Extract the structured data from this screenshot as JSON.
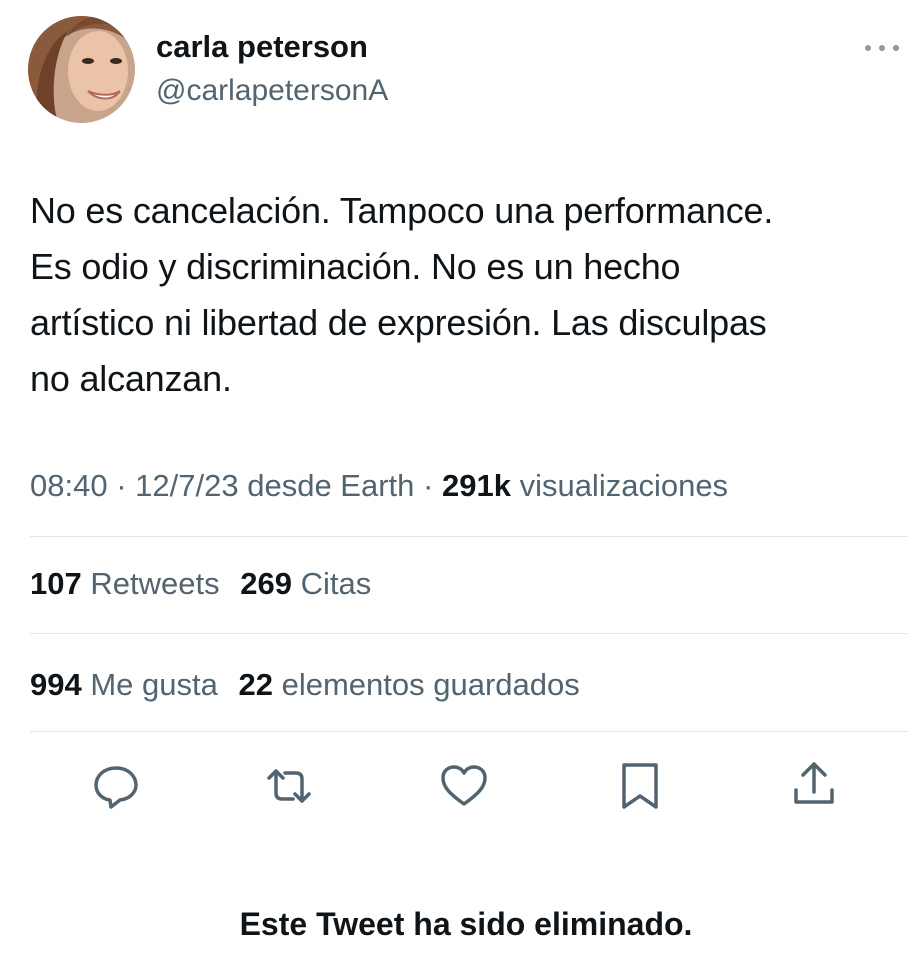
{
  "author": {
    "name": "carla peterson",
    "handle": "@carlapetersonA",
    "avatar_icon": "profile-photo"
  },
  "tweet": {
    "text": "No es cancelación.  Tampoco una performance.\nEs odio y discriminación. No es un hecho\nartístico ni libertad de expresión.  Las disculpas\nno alcanzan.",
    "time": "08:40",
    "date": "12/7/23",
    "source": "desde Earth",
    "separator": "·",
    "views_count": "291k",
    "views_label": "visualizaciones"
  },
  "stats": {
    "retweets_count": "107",
    "retweets_label": "Retweets",
    "quotes_count": "269",
    "quotes_label": "Citas",
    "likes_count": "994",
    "likes_label": "Me gusta",
    "bookmarks_count": "22",
    "bookmarks_label": "elementos guardados"
  },
  "actions": [
    "reply-icon",
    "retweet-icon",
    "like-icon",
    "bookmark-icon",
    "share-icon"
  ],
  "footer": {
    "notice": "Este Tweet ha sido eliminado."
  },
  "colors": {
    "text_primary": "#0f1419",
    "text_secondary": "#536471",
    "divider": "#e1e6ea"
  }
}
